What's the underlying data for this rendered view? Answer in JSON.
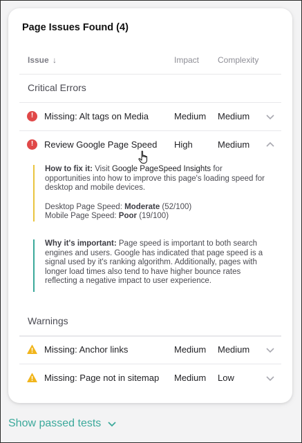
{
  "card": {
    "title": "Page Issues Found (4)",
    "columns": {
      "issue": "Issue",
      "issue_sort": "↓",
      "impact": "Impact",
      "complexity": "Complexity"
    }
  },
  "sections": {
    "critical": "Critical Errors",
    "warnings": "Warnings"
  },
  "rows": [
    {
      "icon": "error-icon",
      "label": "Missing: Alt tags on Media",
      "impact": "Medium",
      "complexity": "Medium",
      "expanded": false
    },
    {
      "icon": "error-icon",
      "label": "Review Google Page Speed",
      "impact": "High",
      "complexity": "Medium",
      "expanded": true
    },
    {
      "icon": "warning-icon",
      "label": "Missing: Anchor links",
      "impact": "Medium",
      "complexity": "Medium",
      "expanded": false
    },
    {
      "icon": "warning-icon",
      "label": "Missing: Page not in sitemap",
      "impact": "Medium",
      "complexity": "Low",
      "expanded": false
    }
  ],
  "detail": {
    "fix_heading": "How to fix it:",
    "fix_text_1": "Visit",
    "fix_link": "Google PageSpeed Insights",
    "fix_text_2": "for opportunities into how to improve this page's loading speed for desktop and mobile devices.",
    "desktop_label": "Desktop Page Speed:",
    "desktop_rating": "Moderate",
    "desktop_score": "(52/100)",
    "mobile_label": "Mobile Page Speed:",
    "mobile_rating": "Poor",
    "mobile_score": "(19/100)",
    "why_heading": "Why it's important:",
    "why_text": "Page speed is important to both search engines and users. Google has indicated that page speed is a signal used by it's ranking algorithm. Additionally, pages with longer load times also tend to have higher bounce rates reflecting a negative impact to user experience."
  },
  "footer": {
    "show_passed": "Show passed tests"
  },
  "colors": {
    "error": "#e04848",
    "warning": "#f1b51c",
    "fix_accent": "#e9c43e",
    "why_accent": "#3aa89a",
    "link_teal": "#3ba99b"
  }
}
